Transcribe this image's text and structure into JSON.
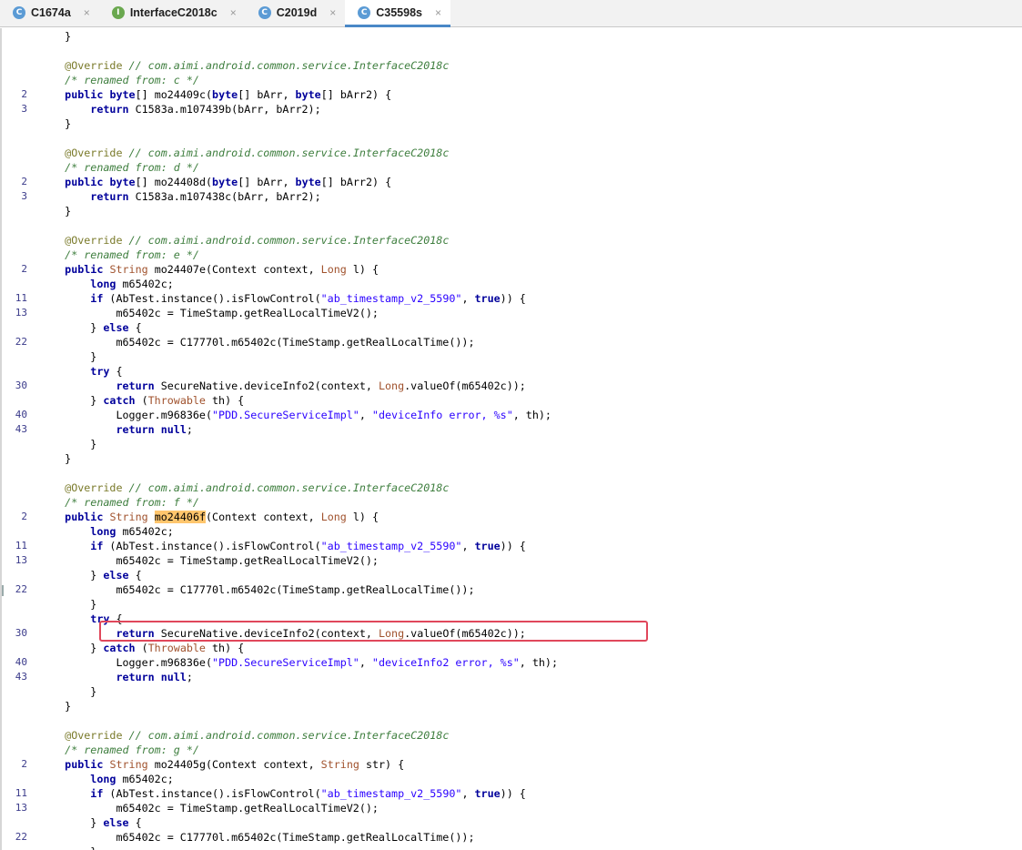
{
  "tabs": [
    {
      "label": "C1674a",
      "icon": "class-icon",
      "letter": "C",
      "kind": "c",
      "active": false
    },
    {
      "label": "InterfaceC2018c",
      "icon": "interface-icon",
      "letter": "I",
      "kind": "i",
      "active": false
    },
    {
      "label": "C2019d",
      "icon": "class-icon",
      "letter": "C",
      "kind": "c",
      "active": false
    },
    {
      "label": "C35598s",
      "icon": "class-icon",
      "letter": "C",
      "kind": "c",
      "active": true
    }
  ],
  "close_glyph": "×",
  "highlight_color": "#e0475b",
  "search_highlight": "#ffc66d",
  "code_lines": [
    {
      "n": "",
      "t": [
        [
          "    }",
          "p"
        ]
      ]
    },
    {
      "n": "",
      "t": [
        [
          "",
          "p"
        ]
      ]
    },
    {
      "n": "",
      "t": [
        [
          "    ",
          "p"
        ],
        [
          "@Override",
          "ann"
        ],
        [
          " // com.aimi.android.common.service.InterfaceC2018c",
          "com"
        ]
      ]
    },
    {
      "n": "",
      "t": [
        [
          "    ",
          "p"
        ],
        [
          "/* renamed from: c */",
          "com"
        ]
      ]
    },
    {
      "n": "2",
      "t": [
        [
          "    ",
          "p"
        ],
        [
          "public",
          "kw"
        ],
        [
          " ",
          "p"
        ],
        [
          "byte",
          "kw"
        ],
        [
          "[] mo24409c(",
          "p"
        ],
        [
          "byte",
          "kw"
        ],
        [
          "[] bArr, ",
          "p"
        ],
        [
          "byte",
          "kw"
        ],
        [
          "[] bArr2) {",
          "p"
        ]
      ]
    },
    {
      "n": "3",
      "t": [
        [
          "        ",
          "p"
        ],
        [
          "return",
          "kw"
        ],
        [
          " C1583a.m107439b(bArr, bArr2);",
          "p"
        ]
      ]
    },
    {
      "n": "",
      "t": [
        [
          "    }",
          "p"
        ]
      ]
    },
    {
      "n": "",
      "t": [
        [
          "",
          "p"
        ]
      ]
    },
    {
      "n": "",
      "t": [
        [
          "    ",
          "p"
        ],
        [
          "@Override",
          "ann"
        ],
        [
          " // com.aimi.android.common.service.InterfaceC2018c",
          "com"
        ]
      ]
    },
    {
      "n": "",
      "t": [
        [
          "    ",
          "p"
        ],
        [
          "/* renamed from: d */",
          "com"
        ]
      ]
    },
    {
      "n": "2",
      "t": [
        [
          "    ",
          "p"
        ],
        [
          "public",
          "kw"
        ],
        [
          " ",
          "p"
        ],
        [
          "byte",
          "kw"
        ],
        [
          "[] mo24408d(",
          "p"
        ],
        [
          "byte",
          "kw"
        ],
        [
          "[] bArr, ",
          "p"
        ],
        [
          "byte",
          "kw"
        ],
        [
          "[] bArr2) {",
          "p"
        ]
      ]
    },
    {
      "n": "3",
      "t": [
        [
          "        ",
          "p"
        ],
        [
          "return",
          "kw"
        ],
        [
          " C1583a.m107438c(bArr, bArr2);",
          "p"
        ]
      ]
    },
    {
      "n": "",
      "t": [
        [
          "    }",
          "p"
        ]
      ]
    },
    {
      "n": "",
      "t": [
        [
          "",
          "p"
        ]
      ]
    },
    {
      "n": "",
      "t": [
        [
          "    ",
          "p"
        ],
        [
          "@Override",
          "ann"
        ],
        [
          " // com.aimi.android.common.service.InterfaceC2018c",
          "com"
        ]
      ]
    },
    {
      "n": "",
      "t": [
        [
          "    ",
          "p"
        ],
        [
          "/* renamed from: e */",
          "com"
        ]
      ]
    },
    {
      "n": "2",
      "t": [
        [
          "    ",
          "p"
        ],
        [
          "public",
          "kw"
        ],
        [
          " ",
          "p"
        ],
        [
          "String",
          "typ"
        ],
        [
          " mo24407e(Context context, ",
          "p"
        ],
        [
          "Long",
          "typ"
        ],
        [
          " l) {",
          "p"
        ]
      ]
    },
    {
      "n": "",
      "t": [
        [
          "        ",
          "p"
        ],
        [
          "long",
          "kw"
        ],
        [
          " m65402c;",
          "p"
        ]
      ]
    },
    {
      "n": "11",
      "t": [
        [
          "        ",
          "p"
        ],
        [
          "if",
          "kw"
        ],
        [
          " (AbTest.instance().isFlowControl(",
          "p"
        ],
        [
          "\"ab_timestamp_v2_5590\"",
          "str"
        ],
        [
          ", ",
          "p"
        ],
        [
          "true",
          "kw"
        ],
        [
          ")) {",
          "p"
        ]
      ]
    },
    {
      "n": "13",
      "t": [
        [
          "            m65402c = TimeStamp.getRealLocalTimeV2();",
          "p"
        ]
      ]
    },
    {
      "n": "",
      "t": [
        [
          "        } ",
          "p"
        ],
        [
          "else",
          "kw"
        ],
        [
          " {",
          "p"
        ]
      ]
    },
    {
      "n": "22",
      "t": [
        [
          "            m65402c = C17770l.m65402c(TimeStamp.getRealLocalTime());",
          "p"
        ]
      ]
    },
    {
      "n": "",
      "t": [
        [
          "        }",
          "p"
        ]
      ]
    },
    {
      "n": "",
      "t": [
        [
          "        ",
          "p"
        ],
        [
          "try",
          "kw"
        ],
        [
          " {",
          "p"
        ]
      ]
    },
    {
      "n": "30",
      "t": [
        [
          "            ",
          "p"
        ],
        [
          "return",
          "kw"
        ],
        [
          " SecureNative.deviceInfo2(context, ",
          "p"
        ],
        [
          "Long",
          "typ"
        ],
        [
          ".valueOf(m65402c));",
          "p"
        ]
      ]
    },
    {
      "n": "",
      "t": [
        [
          "        } ",
          "p"
        ],
        [
          "catch",
          "kw"
        ],
        [
          " (",
          "p"
        ],
        [
          "Throwable",
          "typ"
        ],
        [
          " th) {",
          "p"
        ]
      ]
    },
    {
      "n": "40",
      "t": [
        [
          "            Logger.m96836e(",
          "p"
        ],
        [
          "\"PDD.SecureServiceImpl\"",
          "str"
        ],
        [
          ", ",
          "p"
        ],
        [
          "\"deviceInfo error, %s\"",
          "str"
        ],
        [
          ", th);",
          "p"
        ]
      ]
    },
    {
      "n": "43",
      "t": [
        [
          "            ",
          "p"
        ],
        [
          "return",
          "kw"
        ],
        [
          " ",
          "p"
        ],
        [
          "null",
          "kw"
        ],
        [
          ";",
          "p"
        ]
      ]
    },
    {
      "n": "",
      "t": [
        [
          "        }",
          "p"
        ]
      ]
    },
    {
      "n": "",
      "t": [
        [
          "    }",
          "p"
        ]
      ]
    },
    {
      "n": "",
      "t": [
        [
          "",
          "p"
        ]
      ]
    },
    {
      "n": "",
      "t": [
        [
          "    ",
          "p"
        ],
        [
          "@Override",
          "ann"
        ],
        [
          " // com.aimi.android.common.service.InterfaceC2018c",
          "com"
        ]
      ]
    },
    {
      "n": "",
      "t": [
        [
          "    ",
          "p"
        ],
        [
          "/* renamed from: f */",
          "com"
        ]
      ]
    },
    {
      "n": "2",
      "t": [
        [
          "    ",
          "p"
        ],
        [
          "public",
          "kw"
        ],
        [
          " ",
          "p"
        ],
        [
          "String",
          "typ"
        ],
        [
          " ",
          "p"
        ],
        [
          "mo24406f",
          "hl"
        ],
        [
          "(Context context, ",
          "p"
        ],
        [
          "Long",
          "typ"
        ],
        [
          " l) {",
          "p"
        ]
      ]
    },
    {
      "n": "",
      "t": [
        [
          "        ",
          "p"
        ],
        [
          "long",
          "kw"
        ],
        [
          " m65402c;",
          "p"
        ]
      ]
    },
    {
      "n": "11",
      "t": [
        [
          "        ",
          "p"
        ],
        [
          "if",
          "kw"
        ],
        [
          " (AbTest.instance().isFlowControl(",
          "p"
        ],
        [
          "\"ab_timestamp_v2_5590\"",
          "str"
        ],
        [
          ", ",
          "p"
        ],
        [
          "true",
          "kw"
        ],
        [
          ")) {",
          "p"
        ]
      ]
    },
    {
      "n": "13",
      "t": [
        [
          "            m65402c = TimeStamp.getRealLocalTimeV2();",
          "p"
        ]
      ]
    },
    {
      "n": "",
      "t": [
        [
          "        } ",
          "p"
        ],
        [
          "else",
          "kw"
        ],
        [
          " {",
          "p"
        ]
      ]
    },
    {
      "n": "22",
      "t": [
        [
          "            m65402c = C17770l.m65402c(TimeStamp.getRealLocalTime());",
          "p"
        ]
      ]
    },
    {
      "n": "",
      "t": [
        [
          "        }",
          "p"
        ]
      ]
    },
    {
      "n": "",
      "t": [
        [
          "        ",
          "p"
        ],
        [
          "try",
          "kw"
        ],
        [
          " {",
          "p"
        ]
      ]
    },
    {
      "n": "30",
      "t": [
        [
          "            ",
          "p"
        ],
        [
          "return",
          "kw"
        ],
        [
          " SecureNative.deviceInfo2(context, ",
          "p"
        ],
        [
          "Long",
          "typ"
        ],
        [
          ".valueOf(m65402c));",
          "p"
        ]
      ]
    },
    {
      "n": "",
      "t": [
        [
          "        } ",
          "p"
        ],
        [
          "catch",
          "kw"
        ],
        [
          " (",
          "p"
        ],
        [
          "Throwable",
          "typ"
        ],
        [
          " th) {",
          "p"
        ]
      ]
    },
    {
      "n": "40",
      "t": [
        [
          "            Logger.m96836e(",
          "p"
        ],
        [
          "\"PDD.SecureServiceImpl\"",
          "str"
        ],
        [
          ", ",
          "p"
        ],
        [
          "\"deviceInfo2 error, %s\"",
          "str"
        ],
        [
          ", th);",
          "p"
        ]
      ]
    },
    {
      "n": "43",
      "t": [
        [
          "            ",
          "p"
        ],
        [
          "return",
          "kw"
        ],
        [
          " ",
          "p"
        ],
        [
          "null",
          "kw"
        ],
        [
          ";",
          "p"
        ]
      ]
    },
    {
      "n": "",
      "t": [
        [
          "        }",
          "p"
        ]
      ]
    },
    {
      "n": "",
      "t": [
        [
          "    }",
          "p"
        ]
      ]
    },
    {
      "n": "",
      "t": [
        [
          "",
          "p"
        ]
      ]
    },
    {
      "n": "",
      "t": [
        [
          "    ",
          "p"
        ],
        [
          "@Override",
          "ann"
        ],
        [
          " // com.aimi.android.common.service.InterfaceC2018c",
          "com"
        ]
      ]
    },
    {
      "n": "",
      "t": [
        [
          "    ",
          "p"
        ],
        [
          "/* renamed from: g */",
          "com"
        ]
      ]
    },
    {
      "n": "2",
      "t": [
        [
          "    ",
          "p"
        ],
        [
          "public",
          "kw"
        ],
        [
          " ",
          "p"
        ],
        [
          "String",
          "typ"
        ],
        [
          " mo24405g(Context context, ",
          "p"
        ],
        [
          "String",
          "typ"
        ],
        [
          " str) {",
          "p"
        ]
      ]
    },
    {
      "n": "",
      "t": [
        [
          "        ",
          "p"
        ],
        [
          "long",
          "kw"
        ],
        [
          " m65402c;",
          "p"
        ]
      ]
    },
    {
      "n": "11",
      "t": [
        [
          "        ",
          "p"
        ],
        [
          "if",
          "kw"
        ],
        [
          " (AbTest.instance().isFlowControl(",
          "p"
        ],
        [
          "\"ab_timestamp_v2_5590\"",
          "str"
        ],
        [
          ", ",
          "p"
        ],
        [
          "true",
          "kw"
        ],
        [
          ")) {",
          "p"
        ]
      ]
    },
    {
      "n": "13",
      "t": [
        [
          "            m65402c = TimeStamp.getRealLocalTimeV2();",
          "p"
        ]
      ]
    },
    {
      "n": "",
      "t": [
        [
          "        } ",
          "p"
        ],
        [
          "else",
          "kw"
        ],
        [
          " {",
          "p"
        ]
      ]
    },
    {
      "n": "22",
      "t": [
        [
          "            m65402c = C17770l.m65402c(TimeStamp.getRealLocalTime());",
          "p"
        ]
      ]
    },
    {
      "n": "",
      "t": [
        [
          "        }",
          "p"
        ]
      ]
    }
  ]
}
